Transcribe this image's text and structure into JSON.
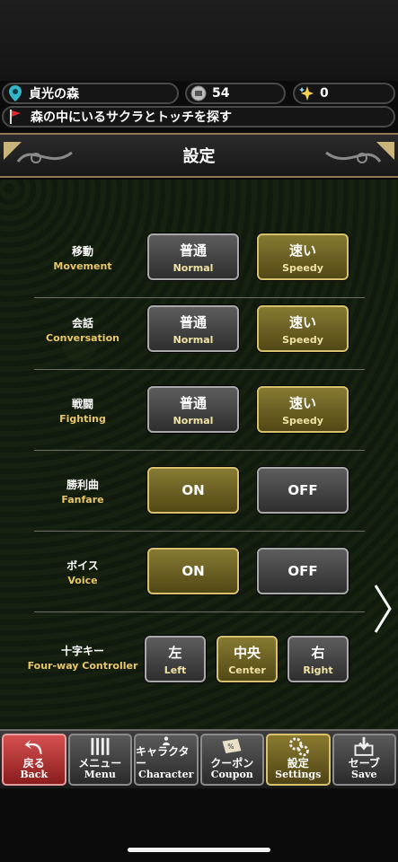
{
  "status": {
    "location": "貞光の森",
    "coins": "54",
    "gems": "0",
    "quest": "森の中にいるサクラとトッチを探す"
  },
  "title": "設定",
  "settings": [
    {
      "jp": "移動",
      "en": "Movement",
      "left": {
        "jp": "普通",
        "en": "Normal"
      },
      "right": {
        "jp": "速い",
        "en": "Speedy"
      },
      "selected": "right"
    },
    {
      "jp": "会話",
      "en": "Conversation",
      "left": {
        "jp": "普通",
        "en": "Normal"
      },
      "right": {
        "jp": "速い",
        "en": "Speedy"
      },
      "selected": "right"
    },
    {
      "jp": "戦闘",
      "en": "Fighting",
      "left": {
        "jp": "普通",
        "en": "Normal"
      },
      "right": {
        "jp": "速い",
        "en": "Speedy"
      },
      "selected": "right"
    },
    {
      "jp": "勝利曲",
      "en": "Fanfare",
      "left": {
        "label": "ON"
      },
      "right": {
        "label": "OFF"
      },
      "selected": "left"
    },
    {
      "jp": "ボイス",
      "en": "Voice",
      "left": {
        "label": "ON"
      },
      "right": {
        "label": "OFF"
      },
      "selected": "left"
    }
  ],
  "controller": {
    "jp": "十字キー",
    "en": "Four-way Controller",
    "options": [
      {
        "jp": "左",
        "en": "Left"
      },
      {
        "jp": "中央",
        "en": "Center"
      },
      {
        "jp": "右",
        "en": "Right"
      }
    ],
    "selected": "Center"
  },
  "footer": [
    {
      "jp": "戻る",
      "en": "Back",
      "icon": "back-arrow-icon"
    },
    {
      "jp": "メニュー",
      "en": "Menu",
      "icon": "menu-icon"
    },
    {
      "jp": "キャラクター",
      "en": "Character",
      "icon": "character-icon"
    },
    {
      "jp": "クーポン",
      "en": "Coupon",
      "icon": "coupon-icon"
    },
    {
      "jp": "設定",
      "en": "Settings",
      "icon": "gear-icon"
    },
    {
      "jp": "セーブ",
      "en": "Save",
      "icon": "save-icon"
    }
  ],
  "colors": {
    "accent_gold": "#d7c16b",
    "label_gold": "#e8c66a",
    "back_red": "#c03a3a"
  }
}
